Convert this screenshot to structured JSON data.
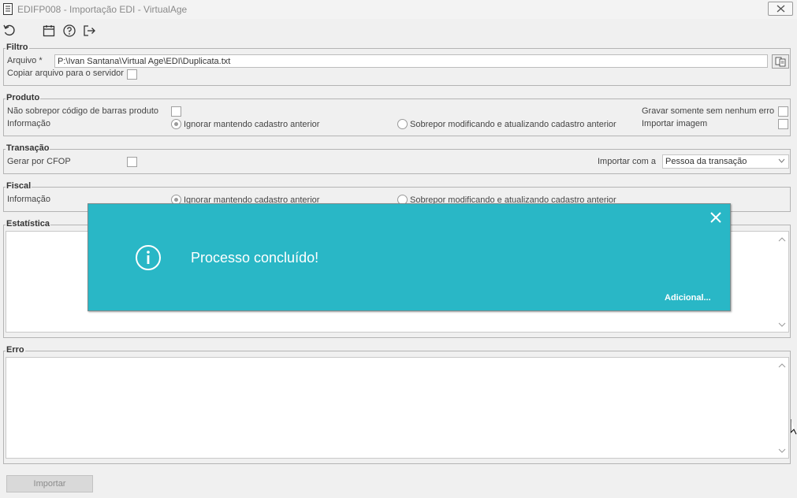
{
  "window": {
    "title": "EDIFP008 - Importação EDI - VirtualAge"
  },
  "toolbar": {
    "icons": [
      "refresh-icon",
      "calendar-icon",
      "help-icon",
      "exit-icon"
    ]
  },
  "filtro": {
    "legend": "Filtro",
    "arquivo_label": "Arquivo *",
    "arquivo_value": "P:\\Ivan Santana\\Virtual Age\\EDI\\Duplicata.txt",
    "copiar_label": "Copiar arquivo para o servidor",
    "copiar_checked": false
  },
  "produto": {
    "legend": "Produto",
    "nao_sobrepor_label": "Não sobrepor código de barras produto",
    "informacao_label": "Informação",
    "radio_ignorar": "Ignorar mantendo cadastro anterior",
    "radio_sobrepor": "Sobrepor modificando e atualizando cadastro anterior",
    "gravar_label": "Gravar somente sem nenhum erro",
    "importar_imagem_label": "Importar imagem"
  },
  "transacao": {
    "legend": "Transação",
    "gerar_cfop_label": "Gerar por CFOP",
    "importar_com_label": "Importar com a",
    "importar_com_value": "Pessoa da transação"
  },
  "fiscal": {
    "legend": "Fiscal",
    "informacao_label": "Informação",
    "radio_ignorar": "Ignorar mantendo cadastro anterior",
    "radio_sobrepor": "Sobrepor modificando e atualizando cadastro anterior"
  },
  "estatistica": {
    "legend": "Estatística"
  },
  "erro": {
    "legend": "Erro"
  },
  "actions": {
    "importar_label": "Importar"
  },
  "toast": {
    "message": "Processo concluído!",
    "more_label": "Adicional...",
    "color": "#29b7c6"
  }
}
